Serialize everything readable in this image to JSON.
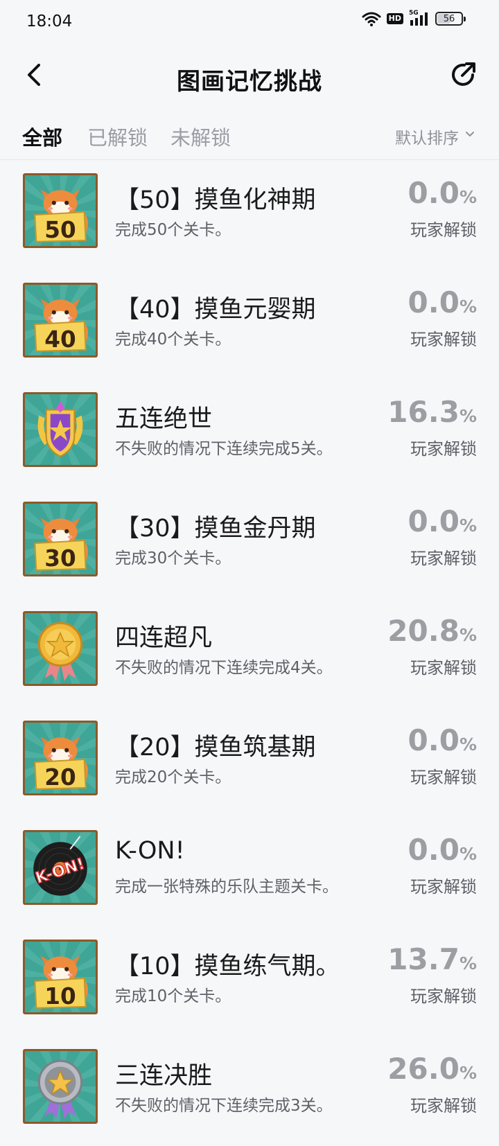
{
  "status_bar": {
    "time": "18:04",
    "network_badge": "HD",
    "network_type": "5G",
    "battery_level": "56"
  },
  "header": {
    "title": "图画记忆挑战",
    "back_icon": "back-arrow-icon",
    "share_icon": "share-icon"
  },
  "tabs": [
    {
      "label": "全部",
      "active": true
    },
    {
      "label": "已解锁",
      "active": false
    },
    {
      "label": "未解锁",
      "active": false
    }
  ],
  "sort": {
    "label": "默认排序",
    "icon": "chevron-down-icon"
  },
  "colors": {
    "badge_bg": "#3fa597",
    "badge_frame": "#8b5a2a",
    "percent_text": "#9b9ea2",
    "background": "#f6f7f9"
  },
  "achievements": [
    {
      "icon": "fox-50-badge-icon",
      "badge_number": "50",
      "title": "【50】摸鱼化神期",
      "description": "完成50个关卡。",
      "percent": "0.0",
      "percent_sign": "%",
      "players_label": "玩家解锁"
    },
    {
      "icon": "fox-40-badge-icon",
      "badge_number": "40",
      "title": "【40】摸鱼元婴期",
      "description": "完成40个关卡。",
      "percent": "0.0",
      "percent_sign": "%",
      "players_label": "玩家解锁"
    },
    {
      "icon": "crown-shield-badge-icon",
      "title": "五连绝世",
      "description": "不失败的情况下连续完成5关。",
      "percent": "16.3",
      "percent_sign": "%",
      "players_label": "玩家解锁"
    },
    {
      "icon": "fox-30-badge-icon",
      "badge_number": "30",
      "title": "【30】摸鱼金丹期",
      "description": "完成30个关卡。",
      "percent": "0.0",
      "percent_sign": "%",
      "players_label": "玩家解锁"
    },
    {
      "icon": "gold-medal-badge-icon",
      "title": "四连超凡",
      "description": "不失败的情况下连续完成4关。",
      "percent": "20.8",
      "percent_sign": "%",
      "players_label": "玩家解锁"
    },
    {
      "icon": "fox-20-badge-icon",
      "badge_number": "20",
      "title": "【20】摸鱼筑基期",
      "description": "完成20个关卡。",
      "percent": "0.0",
      "percent_sign": "%",
      "players_label": "玩家解锁"
    },
    {
      "icon": "vinyl-record-badge-icon",
      "badge_text": "K-ON!",
      "title": "K-ON!",
      "description": "完成一张特殊的乐队主题关卡。",
      "percent": "0.0",
      "percent_sign": "%",
      "players_label": "玩家解锁"
    },
    {
      "icon": "fox-10-badge-icon",
      "badge_number": "10",
      "title": "【10】摸鱼练气期。",
      "description": "完成10个关卡。",
      "percent": "13.7",
      "percent_sign": "%",
      "players_label": "玩家解锁"
    },
    {
      "icon": "silver-medal-badge-icon",
      "title": "三连决胜",
      "description": "不失败的情况下连续完成3关。",
      "percent": "26.0",
      "percent_sign": "%",
      "players_label": "玩家解锁"
    }
  ]
}
